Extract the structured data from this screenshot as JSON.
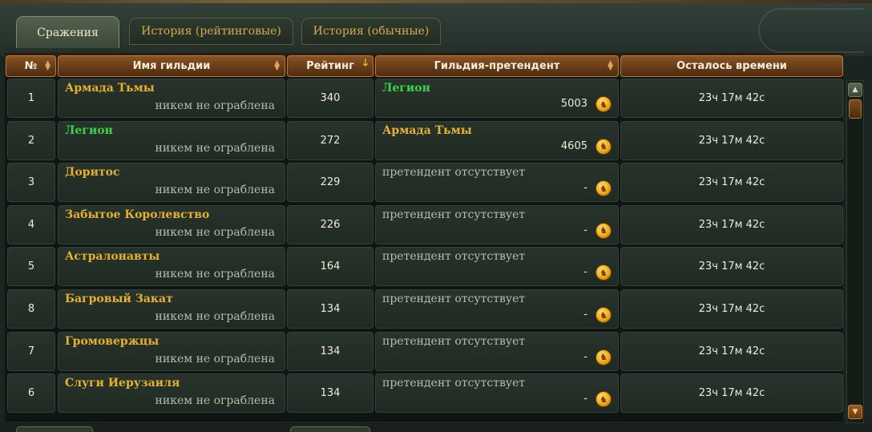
{
  "tabs": [
    {
      "label": "Сражения",
      "active": true
    },
    {
      "label": "История (рейтинговые)",
      "active": false
    },
    {
      "label": "История (обычные)",
      "active": false
    }
  ],
  "columns": {
    "num": "№",
    "guild": "Имя гильдии",
    "rating": "Рейтинг",
    "challenger": "Гильдия-претендент",
    "time": "Осталось времени"
  },
  "sort": {
    "column": "rating",
    "direction": "desc"
  },
  "rows": [
    {
      "num": "1",
      "guild": "Армада Тьмы",
      "guild_color": "yellow",
      "robbed": "никем не ограблена",
      "rating": "340",
      "challenger": "Легион",
      "challenger_color": "green",
      "bid": "5003",
      "time": "23ч 17м 42с"
    },
    {
      "num": "2",
      "guild": "Легион",
      "guild_color": "green",
      "robbed": "никем не ограблена",
      "rating": "272",
      "challenger": "Армада Тьмы",
      "challenger_color": "yellow",
      "bid": "4605",
      "time": "23ч 17м 42с"
    },
    {
      "num": "3",
      "guild": "Доритос",
      "guild_color": "yellow",
      "robbed": "никем не ограблена",
      "rating": "229",
      "challenger": "претендент отсутствует",
      "challenger_color": "grey",
      "bid": "-",
      "time": "23ч 17м 42с"
    },
    {
      "num": "4",
      "guild": "Забытое Королевство",
      "guild_color": "yellow",
      "robbed": "никем не ограблена",
      "rating": "226",
      "challenger": "претендент отсутствует",
      "challenger_color": "grey",
      "bid": "-",
      "time": "23ч 17м 42с"
    },
    {
      "num": "5",
      "guild": "Астралонавты",
      "guild_color": "yellow",
      "robbed": "никем не ограблена",
      "rating": "164",
      "challenger": "претендент отсутствует",
      "challenger_color": "grey",
      "bid": "-",
      "time": "23ч 17м 42с"
    },
    {
      "num": "8",
      "guild": "Багровый Закат",
      "guild_color": "yellow",
      "robbed": "никем не ограблена",
      "rating": "134",
      "challenger": "претендент отсутствует",
      "challenger_color": "grey",
      "bid": "-",
      "time": "23ч 17м 42с"
    },
    {
      "num": "7",
      "guild": "Громовержцы",
      "guild_color": "yellow",
      "robbed": "никем не ограблена",
      "rating": "134",
      "challenger": "претендент отсутствует",
      "challenger_color": "grey",
      "bid": "-",
      "time": "23ч 17м 42с"
    },
    {
      "num": "6",
      "guild": "Слуги Иерузаиля",
      "guild_color": "yellow",
      "robbed": "никем не ограблена",
      "rating": "134",
      "challenger": "претендент отсутствует",
      "challenger_color": "grey",
      "bid": "-",
      "time": "23ч 17м 42с"
    }
  ],
  "colors": {
    "accent_gold": "#e8b030",
    "guild_green": "#3ed24a",
    "muted_text": "#b4bcae",
    "header_brown": "#7a4820"
  },
  "icons": {
    "coin": "gold-coin-icon",
    "sort": "sort-arrows-icon",
    "sort_active": "sort-desc-arrow-icon",
    "scroll_up": "scroll-up-arrow-icon",
    "scroll_down": "scroll-down-arrow-icon"
  }
}
